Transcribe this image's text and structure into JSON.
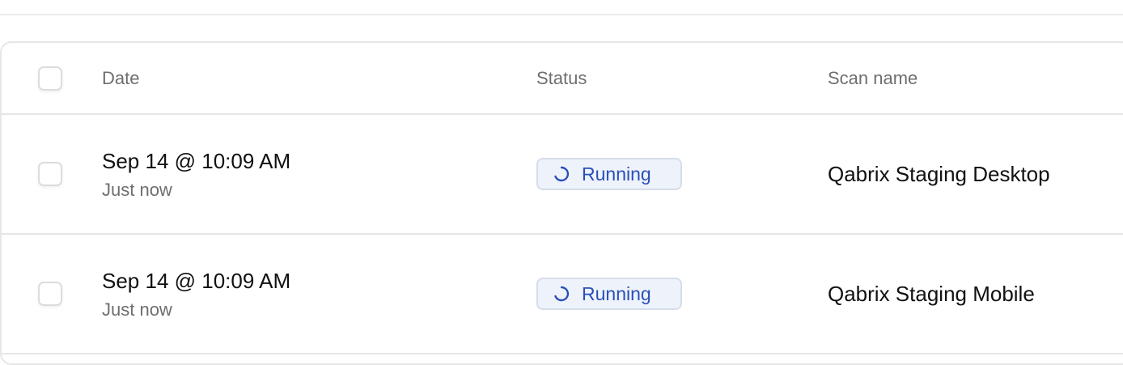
{
  "table": {
    "columns": {
      "date": "Date",
      "status": "Status",
      "scan_name": "Scan name"
    },
    "rows": [
      {
        "date": "Sep 14 @ 10:09 AM",
        "relative": "Just now",
        "status": "Running",
        "scan_name": "Qabrix Staging Desktop"
      },
      {
        "date": "Sep 14 @ 10:09 AM",
        "relative": "Just now",
        "status": "Running",
        "scan_name": "Qabrix Staging Mobile"
      }
    ]
  },
  "colors": {
    "status_running_text": "#2a4fb8",
    "status_running_bg": "#eef3fb",
    "status_running_border": "#d6dde9"
  },
  "icons": {
    "status_running": "spinner-icon"
  }
}
